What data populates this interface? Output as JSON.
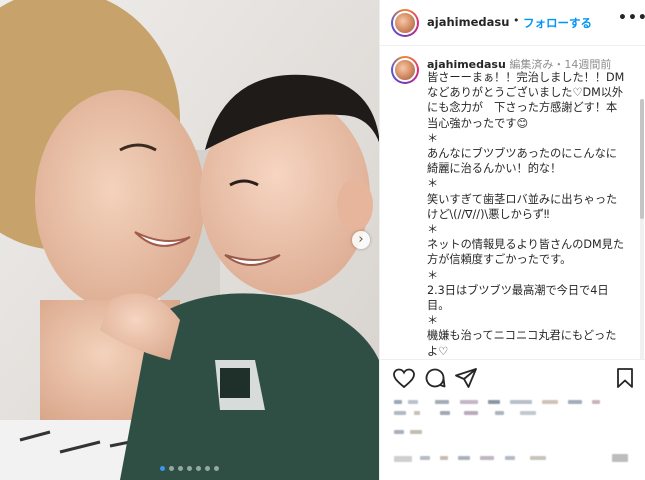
{
  "post": {
    "username": "ajahimedasu",
    "separator": "•",
    "follow_label": "フォローする",
    "more_icon": "•••",
    "next_icon": "›",
    "carousel": {
      "count": 7,
      "active_index": 0
    }
  },
  "caption": {
    "username": "ajahimedasu",
    "edited": "編集済み",
    "time_sep": "・",
    "time_ago": "14週間前",
    "text": "皆さーーまぁ！！完治しました！！DMなどありがとうございました♡DM以外にも念力が　下さった方感謝どす！本当心強かったです😊\n＊\nあんなにブツブツあったのにこんなに綺麗に治るんかい！的な！\n＊\n笑いすぎて歯茎ロバ並みに出ちゃったけど\\(//∇//)\\悪しからず‼︎\n＊\nネットの情報見るより皆さんのDM見た方が信頼度すごかったです。\n＊\n2.3日はブツブツ最高潮で今日で4日目。\n＊\n機嫌も治ってニコニコ丸君にもどったよ♡\n＊"
  },
  "colors": {
    "accent": "#0095f6",
    "border": "#efefef",
    "text": "#262626",
    "muted": "#8e8e8e",
    "carousel_active": "#3897f0"
  },
  "icons": [
    "heart-icon",
    "comment-icon",
    "share-icon",
    "bookmark-icon",
    "chevron-right-icon",
    "more-icon"
  ]
}
